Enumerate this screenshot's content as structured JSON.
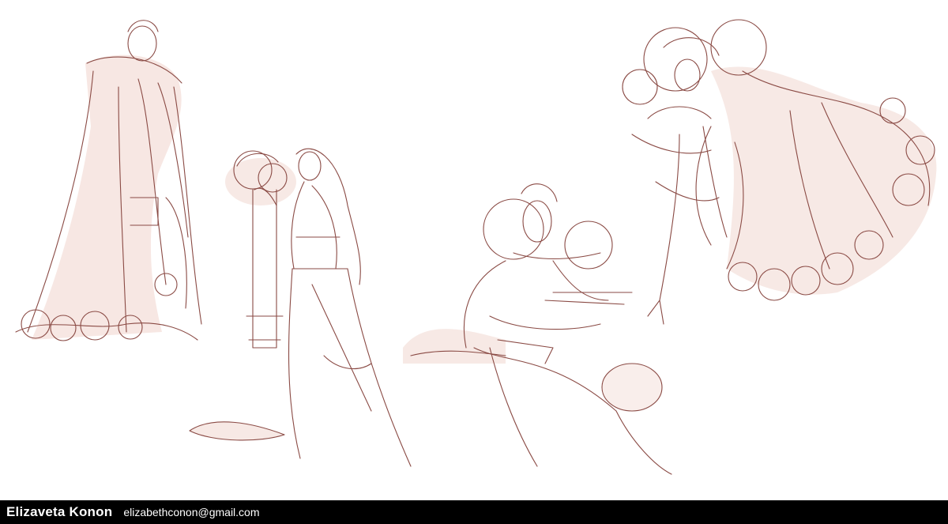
{
  "footer": {
    "artist_name": "Elizaveta Konon",
    "email": "elizabethconon@gmail.com"
  },
  "colors": {
    "line": "#8a4a44",
    "wash": "#f0d4cc",
    "background": "#ffffff",
    "footer_bg": "#000000",
    "footer_text": "#ffffff"
  }
}
